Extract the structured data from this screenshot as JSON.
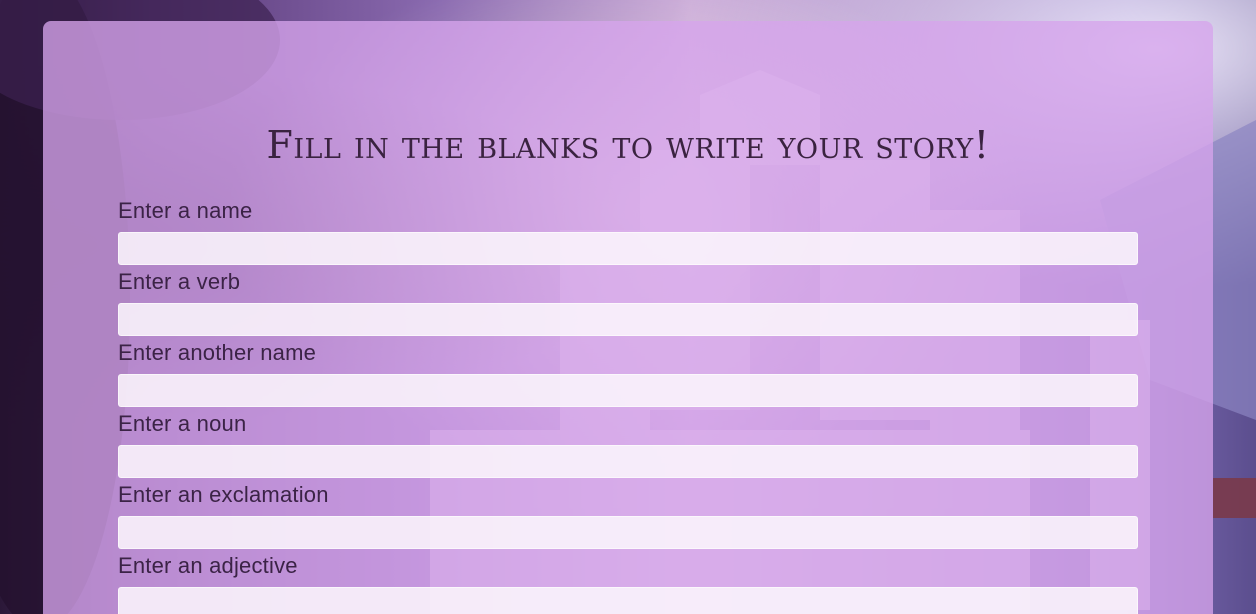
{
  "heading": "Fill in the blanks to write your story!",
  "fields": [
    {
      "label": "Enter a name",
      "value": ""
    },
    {
      "label": "Enter a verb",
      "value": ""
    },
    {
      "label": "Enter another name",
      "value": ""
    },
    {
      "label": "Enter a noun",
      "value": ""
    },
    {
      "label": "Enter an exclamation",
      "value": ""
    },
    {
      "label": "Enter an adjective",
      "value": ""
    }
  ],
  "colors": {
    "panel": "#d6a4ec",
    "text": "#3a2340",
    "input": "#faf5fc"
  }
}
